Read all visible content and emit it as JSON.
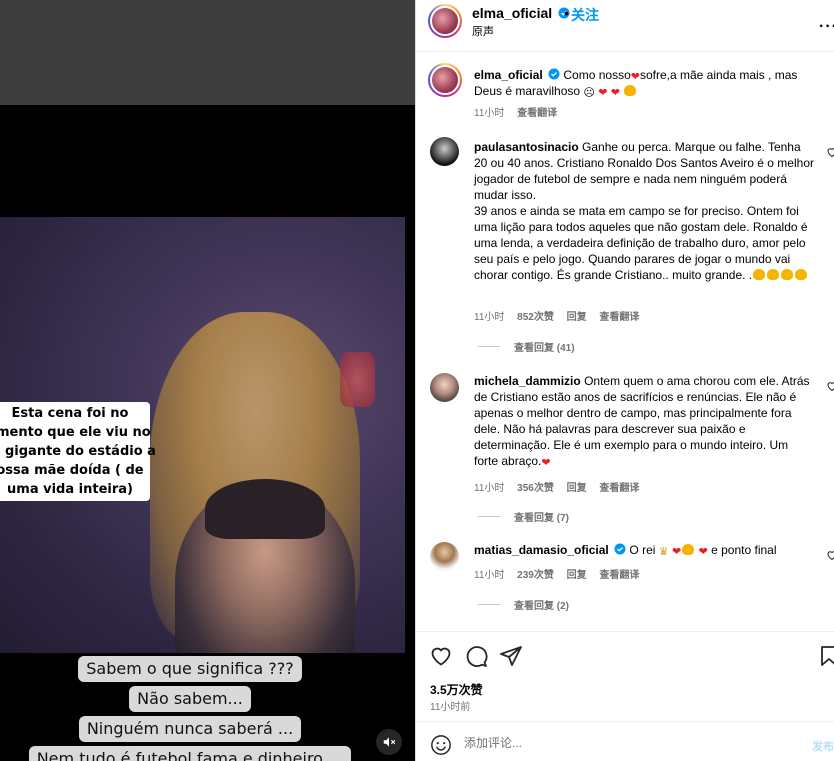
{
  "media": {
    "overlay_lines": [
      "Esta cena foi no",
      "mento que ele viu no",
      "i gigante do estádio a",
      "ossa mãe doída ( de",
      "uma vida inteira)"
    ],
    "caption_lines": [
      "Sabem o que significa ???",
      "Não sabem...",
      "Ninguém nunca saberá ...",
      "Nem tudo é futebol fama e dinheiro ..."
    ],
    "mute_icon": "mute-icon"
  },
  "header": {
    "username": "elma_oficial",
    "separator": "•",
    "follow_label": "关注",
    "subtitle": "原声",
    "more_label": "···"
  },
  "caption": {
    "username": "elma_oficial",
    "text_1": "Como nosso",
    "text_2": "sofre,a mãe ainda mais , mas Deus é maravilhoso",
    "time": "11小时",
    "translate": "查看翻译"
  },
  "comments": [
    {
      "username": "paulasantosinacio",
      "text_1": "Ganhe ou perca. Marque ou falhe. Tenha 20 ou 40 anos. Cristiano Ronaldo Dos Santos Aveiro é o melhor jogador de futebol de sempre e nada nem ninguém poderá mudar isso.",
      "text_2": "39 anos e ainda se mata em campo se for preciso. Ontem foi uma lição para todos aqueles que não gostam dele. Ronaldo é uma lenda, a verdadeira definição de trabalho duro, amor pelo seu país e pelo jogo. Quando parares de jogar o mundo vai chorar contigo. És grande Cristiano.. muito grande. .",
      "time": "11小时",
      "likes": "852次赞",
      "reply": "回复",
      "translate": "查看翻译",
      "view_replies": "查看回复 (41)"
    },
    {
      "username": "michela_dammizio",
      "text_1": "Ontem quem o ama chorou com ele. Atrás de Cristiano estão anos de sacrifícios e renúncias. Ele não é apenas o melhor dentro de campo, mas principalmente fora dele. Não há palavras para descrever sua paixão e determinação. Ele é um exemplo para o mundo inteiro. Um forte abraço.",
      "time": "11小时",
      "likes": "356次赞",
      "reply": "回复",
      "translate": "查看翻译",
      "view_replies": "查看回复 (7)"
    },
    {
      "username": "matias_damasio_oficial",
      "text_1": "O rei",
      "text_2": "e ponto final",
      "time": "11小时",
      "likes": "239次赞",
      "reply": "回复",
      "translate": "查看翻译",
      "view_replies": "查看回复 (2)"
    }
  ],
  "actions": {
    "likes": "3.5万次赞",
    "time": "11小时前"
  },
  "add_comment": {
    "placeholder": "添加评论...",
    "post_label": "发布"
  },
  "colors": {
    "link_blue": "#0095f6",
    "muted": "#737373",
    "heart_red": "#ed1c24"
  }
}
